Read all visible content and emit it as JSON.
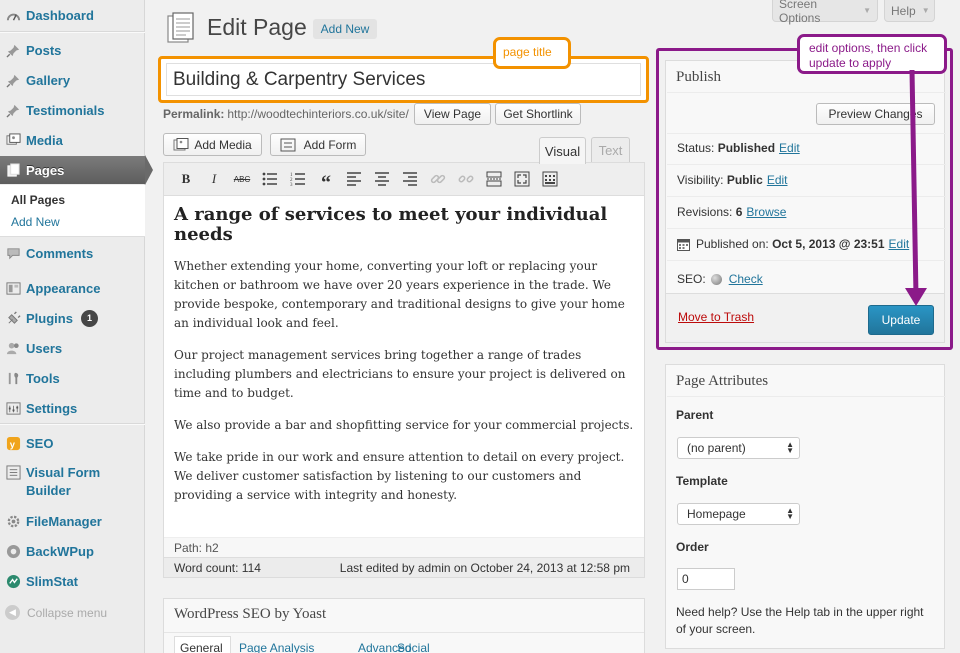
{
  "sidebar": {
    "items": [
      {
        "label": "Dashboard",
        "icon": "dashboard-icon"
      },
      {
        "label": "Posts",
        "icon": "pin-icon"
      },
      {
        "label": "Gallery",
        "icon": "pin-icon"
      },
      {
        "label": "Testimonials",
        "icon": "pin-icon"
      },
      {
        "label": "Media",
        "icon": "media-icon"
      },
      {
        "label": "Pages",
        "icon": "pages-icon"
      },
      {
        "label": "Comments",
        "icon": "comment-icon"
      },
      {
        "label": "Appearance",
        "icon": "appearance-icon"
      },
      {
        "label": "Plugins",
        "icon": "plugin-icon",
        "badge": "1"
      },
      {
        "label": "Users",
        "icon": "users-icon"
      },
      {
        "label": "Tools",
        "icon": "tools-icon"
      },
      {
        "label": "Settings",
        "icon": "settings-icon"
      },
      {
        "label": "SEO",
        "icon": "seo-icon"
      },
      {
        "label": "Visual Form Builder",
        "icon": "form-icon"
      },
      {
        "label": "FileManager",
        "icon": "gear-icon"
      },
      {
        "label": "BackWPup",
        "icon": "backup-icon"
      },
      {
        "label": "SlimStat",
        "icon": "stats-icon"
      }
    ],
    "submenu": [
      "All Pages",
      "Add New"
    ],
    "collapse": "Collapse menu"
  },
  "top": {
    "screen_options": "Screen Options",
    "help": "Help",
    "heading": "Edit Page",
    "add_new": "Add New"
  },
  "post": {
    "title": "Building & Carpentry Services",
    "permalink_label": "Permalink:",
    "permalink_url": "http://woodtechinteriors.co.uk/site/",
    "view_page": "View Page",
    "get_shortlink": "Get Shortlink",
    "add_media": "Add Media",
    "add_form": "Add Form",
    "tab_visual": "Visual",
    "tab_text": "Text"
  },
  "content": {
    "heading": "A range of services to meet your individual needs",
    "paragraphs": [
      "Whether extending your home, converting your loft or replacing your kitchen or bathroom we have over 20 years experience in the trade. We provide bespoke, contemporary and traditional designs to give your home an individual look and feel.",
      "Our project management services bring together a range of trades including plumbers and electricians to ensure your project is delivered on time and to budget.",
      "We also provide a bar and shopfitting service for your commercial projects.",
      "We take pride in our work and ensure attention to detail on every project. We deliver customer satisfaction by listening to our customers and providing a service with integrity and honesty."
    ],
    "path": "Path: h2",
    "word_count": "Word count: 114",
    "last_edited": "Last edited by admin on October 24, 2013 at 12:58 pm"
  },
  "seo_box": {
    "title": "WordPress SEO by Yoast",
    "tabs": [
      "General",
      "Page Analysis",
      "Advanced",
      "Social"
    ]
  },
  "publish": {
    "title": "Publish",
    "preview": "Preview Changes",
    "status_label": "Status:",
    "status_value": "Published",
    "visibility_label": "Visibility:",
    "visibility_value": "Public",
    "revisions_label": "Revisions:",
    "revisions_value": "6",
    "browse": "Browse",
    "published_on_label": "Published on:",
    "published_on_value": "Oct 5, 2013 @ 23:51",
    "seo_label": "SEO:",
    "check": "Check",
    "edit": "Edit",
    "trash": "Move to Trash",
    "update": "Update"
  },
  "attributes": {
    "title": "Page Attributes",
    "parent_label": "Parent",
    "parent_value": "(no parent)",
    "template_label": "Template",
    "template_value": "Homepage",
    "order_label": "Order",
    "order_value": "0",
    "help": "Need help? Use the Help tab in the upper right of your screen."
  },
  "annotations": {
    "orange": "page title",
    "purple": "edit options, then click update to apply",
    "orange_color": "#f39200",
    "purple_color": "#8b1a89"
  }
}
